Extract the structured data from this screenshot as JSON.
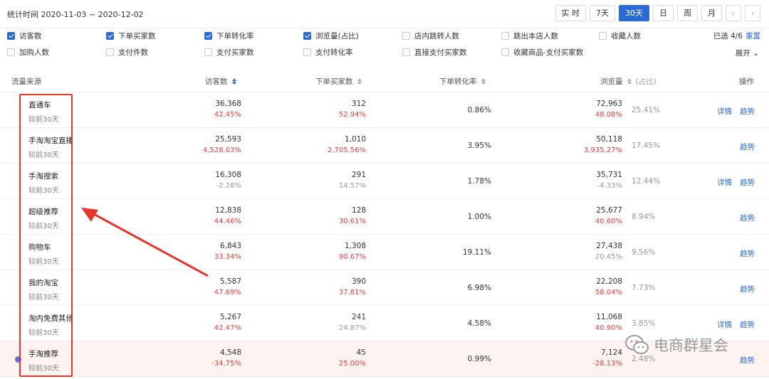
{
  "header": {
    "stat_time": "统计时间 2020-11-03 ~ 2020-12-02",
    "range_buttons": [
      "实 时",
      "7天",
      "30天",
      "日",
      "周",
      "月"
    ],
    "active_range": "30天",
    "prev_icon": "chevron-left-icon",
    "next_icon": "chevron-right-icon"
  },
  "filters": {
    "row1": [
      {
        "label": "访客数",
        "checked": true
      },
      {
        "label": "下单买家数",
        "checked": true
      },
      {
        "label": "下单转化率",
        "checked": true
      },
      {
        "label": "浏览量(占比)",
        "checked": true
      },
      {
        "label": "店内跳转人数",
        "checked": false
      },
      {
        "label": "跳出本店人数",
        "checked": false
      },
      {
        "label": "收藏人数",
        "checked": false
      }
    ],
    "row2": [
      {
        "label": "加购人数",
        "checked": false
      },
      {
        "label": "支付件数",
        "checked": false
      },
      {
        "label": "支付买家数",
        "checked": false
      },
      {
        "label": "支付转化率",
        "checked": false
      },
      {
        "label": "直接支付买家数",
        "checked": false
      },
      {
        "label": "收藏商品-支付买家数",
        "checked": false
      }
    ],
    "selected_count": "已选 4/6",
    "reset_label": "重置",
    "expand_label": "展开"
  },
  "table": {
    "headers": {
      "source": "流量来源",
      "visitors": "访客数",
      "buyers": "下单买家数",
      "conversion": "下单转化率",
      "pageviews": "浏览量",
      "share": "(占比)",
      "ops": "操作"
    },
    "compare_label": "较前30天",
    "ops_labels": {
      "detail": "详情",
      "trend": "趋势"
    },
    "rows": [
      {
        "name": "直通车",
        "visitors": "36,368",
        "visitors_chg": "42.45%",
        "visitors_up": true,
        "buyers": "312",
        "buyers_chg": "52.94%",
        "buyers_up": true,
        "conversion": "0.86%",
        "pv": "72,963",
        "pv_chg": "48.08%",
        "pv_up": true,
        "share": "25.41%",
        "has_detail": true
      },
      {
        "name": "手淘淘宝直播",
        "visitors": "25,593",
        "visitors_chg": "4,528.03%",
        "visitors_up": true,
        "buyers": "1,010",
        "buyers_chg": "2,705.56%",
        "buyers_up": true,
        "conversion": "3.95%",
        "pv": "50,118",
        "pv_chg": "3,935.27%",
        "pv_up": true,
        "share": "17.45%",
        "has_detail": false
      },
      {
        "name": "手淘搜索",
        "visitors": "16,308",
        "visitors_chg": "-2.28%",
        "visitors_up": false,
        "buyers": "291",
        "buyers_chg": "14.57%",
        "buyers_up": false,
        "conversion": "1.78%",
        "pv": "35,731",
        "pv_chg": "-4.33%",
        "pv_up": false,
        "share": "12.44%",
        "has_detail": true
      },
      {
        "name": "超级推荐",
        "visitors": "12,838",
        "visitors_chg": "44.46%",
        "visitors_up": true,
        "buyers": "128",
        "buyers_chg": "30.61%",
        "buyers_up": true,
        "conversion": "1.00%",
        "pv": "25,677",
        "pv_chg": "40.60%",
        "pv_up": true,
        "share": "8.94%",
        "has_detail": false
      },
      {
        "name": "购物车",
        "visitors": "6,843",
        "visitors_chg": "33.34%",
        "visitors_up": true,
        "buyers": "1,308",
        "buyers_chg": "90.67%",
        "buyers_up": true,
        "conversion": "19.11%",
        "pv": "27,438",
        "pv_chg": "20.45%",
        "pv_up": false,
        "share": "9.56%",
        "has_detail": false
      },
      {
        "name": "我的淘宝",
        "visitors": "5,587",
        "visitors_chg": "47.69%",
        "visitors_up": true,
        "buyers": "390",
        "buyers_chg": "37.81%",
        "buyers_up": true,
        "conversion": "6.98%",
        "pv": "22,208",
        "pv_chg": "58.04%",
        "pv_up": true,
        "share": "7.73%",
        "has_detail": false
      },
      {
        "name": "淘内免费其他",
        "visitors": "5,267",
        "visitors_chg": "42.47%",
        "visitors_up": true,
        "buyers": "241",
        "buyers_chg": "24.87%",
        "buyers_up": false,
        "conversion": "4.58%",
        "pv": "11,068",
        "pv_chg": "40.90%",
        "pv_up": true,
        "share": "3.85%",
        "has_detail": true
      },
      {
        "name": "手淘推荐",
        "visitors": "4,548",
        "visitors_chg": "-34.75%",
        "visitors_up": true,
        "buyers": "45",
        "buyers_chg": "25.00%",
        "buyers_up": true,
        "conversion": "0.99%",
        "pv": "7,124",
        "pv_chg": "-28.13%",
        "pv_up": true,
        "share": "2.48%",
        "has_detail": false
      }
    ]
  },
  "watermark": {
    "text": "电商群星会",
    "icon": "wechat-icon"
  },
  "colors": {
    "accent": "#2a6ad4",
    "up": "#ea3b3b",
    "callout": "#e8352b"
  }
}
